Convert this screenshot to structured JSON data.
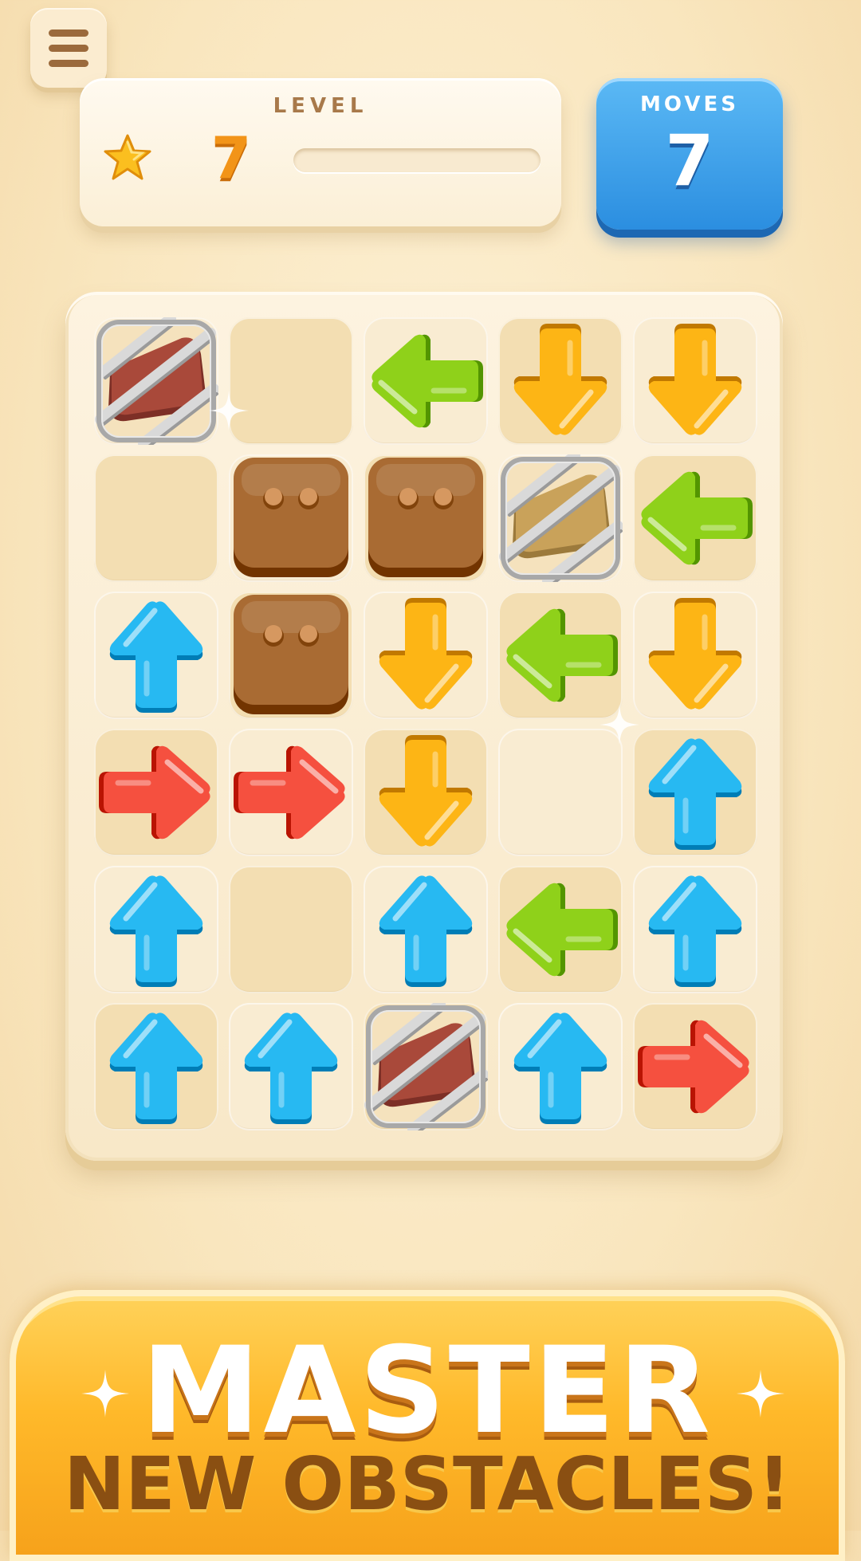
{
  "menu": {
    "icon": "hamburger-menu-icon"
  },
  "level": {
    "title": "LEVEL",
    "number": "7",
    "star_icon": "star-icon",
    "progress": 0
  },
  "moves": {
    "title": "MOVES",
    "count": "7"
  },
  "colors": {
    "up": "#27b9f2",
    "down": "#fdb515",
    "left": "#8fd11a",
    "right": "#f5503f",
    "block": "#a96b33",
    "moves_card": "#3a9ee8",
    "banner": "#ffb92a"
  },
  "board": {
    "rows": 6,
    "cols": 5,
    "grid": [
      [
        "caged-red",
        "empty",
        "left",
        "down",
        "down"
      ],
      [
        "empty",
        "block",
        "block",
        "caged-gold",
        "left"
      ],
      [
        "up",
        "block",
        "down",
        "left",
        "down"
      ],
      [
        "right",
        "right",
        "down",
        "empty",
        "up"
      ],
      [
        "up",
        "empty",
        "up",
        "left",
        "up"
      ],
      [
        "up",
        "up",
        "caged-red",
        "up",
        "right"
      ]
    ]
  },
  "banner": {
    "line1": "MASTER",
    "line2": "NEW OBSTACLES!"
  }
}
